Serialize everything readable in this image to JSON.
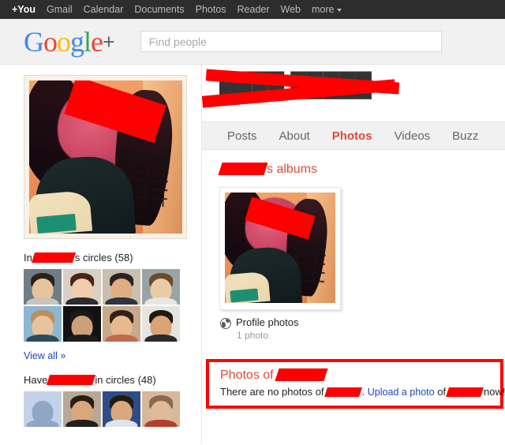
{
  "gbar": {
    "items": [
      {
        "label": "+You",
        "bold": true
      },
      {
        "label": "Gmail",
        "bold": false
      },
      {
        "label": "Calendar",
        "bold": false
      },
      {
        "label": "Documents",
        "bold": false
      },
      {
        "label": "Photos",
        "bold": false
      },
      {
        "label": "Reader",
        "bold": false
      },
      {
        "label": "Web",
        "bold": false
      },
      {
        "label": "more",
        "bold": false
      }
    ]
  },
  "header": {
    "logo": {
      "g1": "G",
      "o1": "o",
      "o2": "o",
      "g2": "g",
      "l": "l",
      "e": "e",
      "plus": "+"
    },
    "search_placeholder": "Find people",
    "search_value": ""
  },
  "profile": {
    "name_redacted": true,
    "photo_alt": "profile-portrait"
  },
  "tabs": [
    {
      "label": "Posts",
      "active": false
    },
    {
      "label": "About",
      "active": false
    },
    {
      "label": "Photos",
      "active": true
    },
    {
      "label": "Videos",
      "active": false
    },
    {
      "label": "Buzz",
      "active": false
    }
  ],
  "sidebar": {
    "in_circles": {
      "prefix": "In",
      "suffix": "s circles",
      "count": "(58)",
      "avatars": [
        {
          "bg": "#6f7d86",
          "head": "#e7c39c",
          "hair": "#2b2118",
          "body": "#c9c5bd"
        },
        {
          "bg": "#d8cfc6",
          "head": "#f0cdad",
          "hair": "#4a2418",
          "body": "#2d2a34"
        },
        {
          "bg": "#c8bfae",
          "head": "#e0ad82",
          "hair": "#2a2420",
          "body": "#2f3340"
        },
        {
          "bg": "#9aa3a6",
          "head": "#edcaa6",
          "hair": "#6b4a2e",
          "body": "#e8e6e2"
        },
        {
          "bg": "#8fb6cf",
          "head": "#e8c49c",
          "hair": "#b8905f",
          "body": "#2f4a5e"
        },
        {
          "bg": "#111111",
          "head": "#caa179",
          "hair": "#1a1a1a",
          "body": "#1d1d1d"
        },
        {
          "bg": "#c9a98b",
          "head": "#e8b98c",
          "hair": "#2e2118",
          "body": "#c06a4e"
        },
        {
          "bg": "#e6e4df",
          "head": "#d8a478",
          "hair": "#1e1914",
          "body": "#2a2a2f"
        }
      ]
    },
    "view_all": "View all »",
    "have_in_circles": {
      "prefix": "Have",
      "suffix": "in circles",
      "count": "(48)",
      "avatars": [
        {
          "bg": "#c3d2e8",
          "head": "#8fa6c4",
          "hair": "#8fa6c4",
          "body": "#8fa6c4"
        },
        {
          "bg": "#b8a897",
          "head": "#d8a87c",
          "hair": "#2a1d14",
          "body": "#20201f"
        },
        {
          "bg": "#2f4c86",
          "head": "#d9a87c",
          "hair": "#241a12",
          "body": "#dfe3ea"
        },
        {
          "bg": "#d8b89a",
          "head": "#e0bb9a",
          "hair": "#8a6a4e",
          "body": "#b4402c"
        }
      ]
    }
  },
  "albums": {
    "title_suffix": "s albums",
    "card": {
      "name": "Profile photos",
      "count": "1 photo",
      "privacy_icon": "globe-icon"
    }
  },
  "photos_of": {
    "title_prefix": "Photos of",
    "text_before": "There are no photos of",
    "text_mid": ".",
    "link": "Upload a photo",
    "text_of": "of",
    "text_end": "now!"
  },
  "colors": {
    "accent_red": "#dd4b39",
    "link_blue": "#2244bb",
    "redaction": "#fe0000",
    "nav_bg": "#2d2d2d",
    "panel_bg": "#f1f1f1"
  }
}
